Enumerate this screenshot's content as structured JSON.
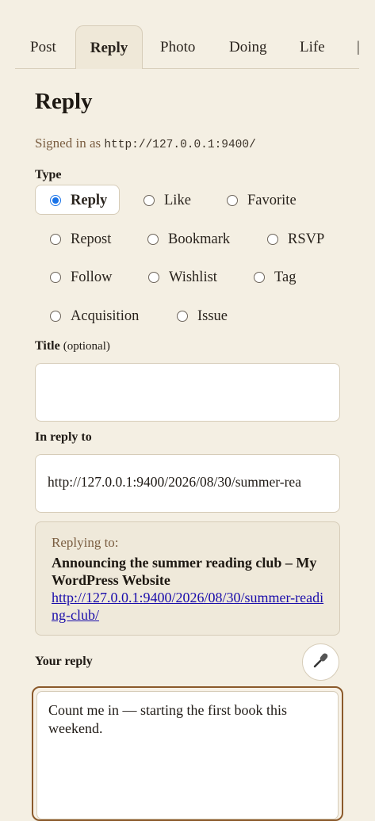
{
  "tabs": [
    {
      "label": "Post"
    },
    {
      "label": "Reply"
    },
    {
      "label": "Photo"
    },
    {
      "label": "Doing"
    },
    {
      "label": "Life"
    }
  ],
  "heading": "Reply",
  "signed_in": {
    "prefix": "Signed in as",
    "url": "http://127.0.0.1:9400/"
  },
  "type_section": {
    "label": "Type",
    "options": [
      "Reply",
      "Like",
      "Favorite",
      "Repost",
      "Bookmark",
      "RSVP",
      "Follow",
      "Wishlist",
      "Tag",
      "Acquisition",
      "Issue"
    ],
    "selected": "Reply"
  },
  "title_field": {
    "label": "Title",
    "optional": "(optional)",
    "value": ""
  },
  "in_reply_to": {
    "label": "In reply to",
    "value": "http://127.0.0.1:9400/2026/08/30/summer-rea"
  },
  "preview": {
    "label": "Replying to:",
    "title": "Announcing the summer reading club – My WordPress Website",
    "url": "http://127.0.0.1:9400/2026/08/30/summer-reading-club/"
  },
  "your_reply": {
    "label": "Your reply",
    "mic_icon": "microphone-icon",
    "value": "Count me in — starting the first book this weekend."
  }
}
